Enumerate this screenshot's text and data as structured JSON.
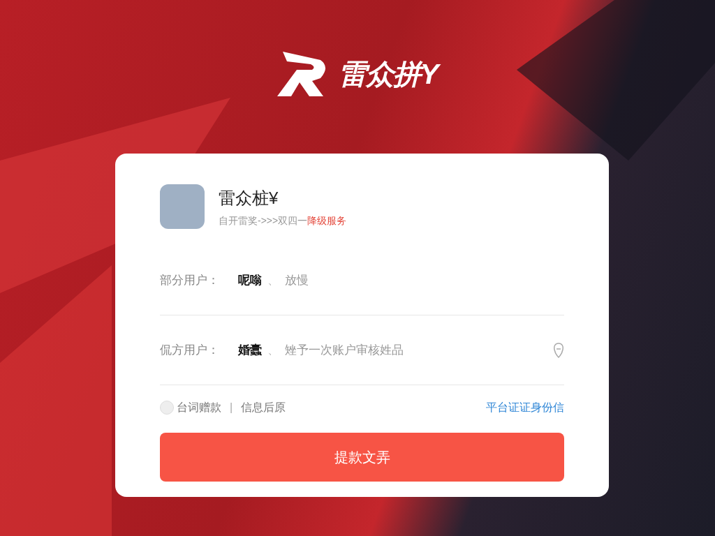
{
  "logo": {
    "text": "雷众拼Y"
  },
  "profile": {
    "name": "雷众桩¥",
    "subtitle": "自开雷奖->>>双四一",
    "subtitle_highlight": "降级服务"
  },
  "fields": [
    {
      "label": "部分用户：",
      "value": "呢嗡",
      "separator": "、",
      "placeholder": "放慢"
    },
    {
      "label": "侃方用户：",
      "value": "婚蠹",
      "separator": "、",
      "placeholder": "矬予一次账户审核姓品"
    }
  ],
  "agreement": {
    "checked": false,
    "label": "台词赠款",
    "divider": "|",
    "extra": "信息后原"
  },
  "link": "平台证证身份信",
  "submit": "提款文弄"
}
